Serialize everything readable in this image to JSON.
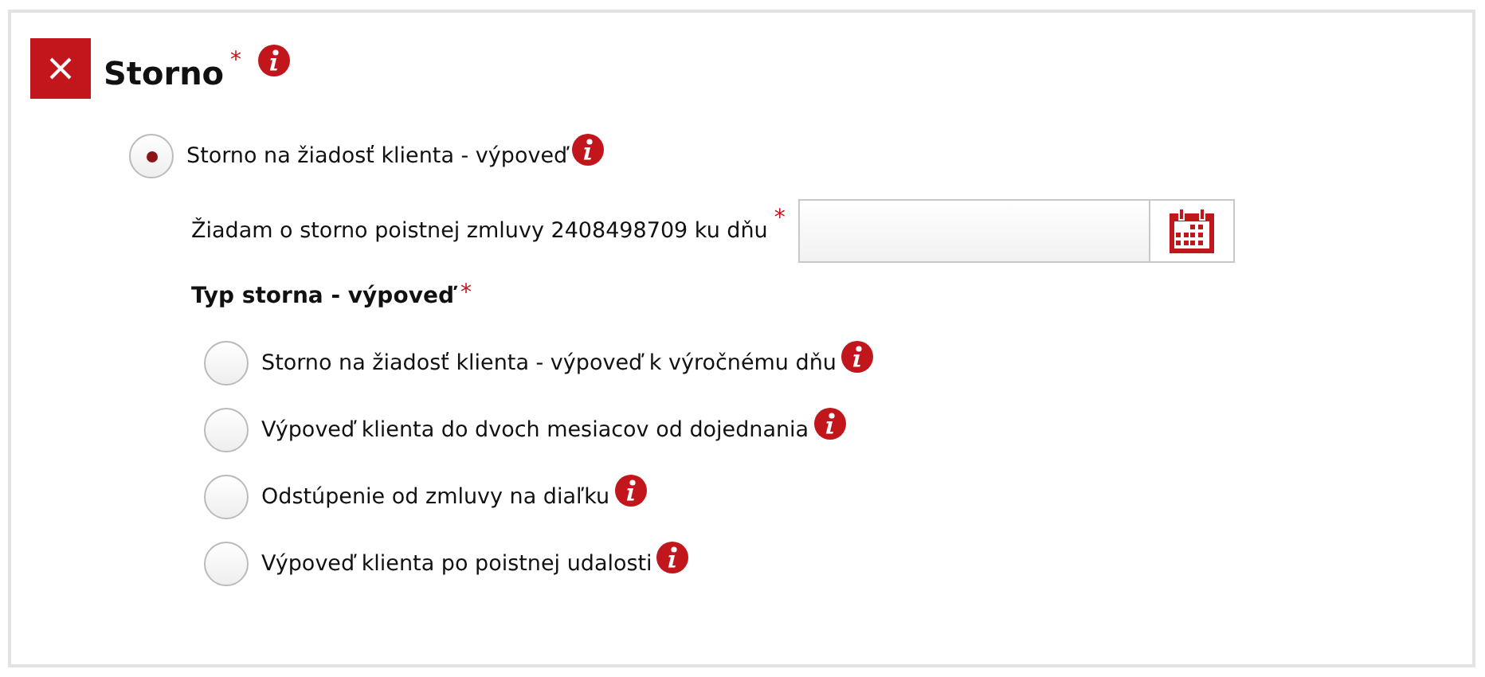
{
  "section": {
    "title": "Storno",
    "required_mark": "*",
    "collapse_icon": true
  },
  "main_option": {
    "label": "Storno na žiadosť klienta - výpoveď",
    "selected": true
  },
  "date_field": {
    "label": "Žiadam o storno poistnej zmluvy 2408498709 ku dňu",
    "required_mark": "*"
  },
  "type_group": {
    "title": "Typ storna - výpoveď",
    "required_mark": "*"
  },
  "type_options": [
    {
      "label": "Storno na žiadosť klienta - výpoveď k výročnému dňu",
      "selected": false
    },
    {
      "label": "Výpoveď klienta do dvoch mesiacov od dojednania",
      "selected": false
    },
    {
      "label": "Odstúpenie od zmluvy na diaľku",
      "selected": false
    },
    {
      "label": "Výpoveď klienta po poistnej udalosti",
      "selected": false
    }
  ]
}
